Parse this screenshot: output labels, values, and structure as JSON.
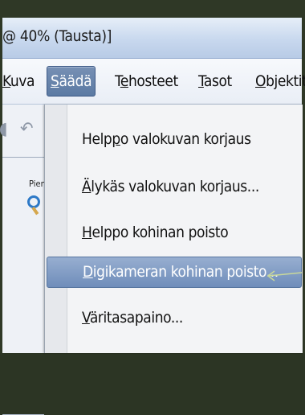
{
  "window": {
    "title": "@ 40% (Tausta)]"
  },
  "menubar": {
    "items": [
      {
        "label": "Kuva",
        "underline_index": 0
      },
      {
        "label": "Säädä",
        "underline_index": 0
      },
      {
        "label": "Tehosteet",
        "underline_index": 1
      },
      {
        "label": "Tasot",
        "underline_index": 0
      },
      {
        "label": "Objektit",
        "underline_index": 0
      }
    ],
    "active": "Säädä"
  },
  "toolbar": {
    "partial_label": "Pien"
  },
  "dropdown": {
    "items": [
      {
        "pre": "Help",
        "u": "p",
        "post": "o valokuvan korjaus"
      },
      {
        "pre": "",
        "u": "Ä",
        "post": "lykäs valokuvan korjaus..."
      },
      {
        "pre": "",
        "u": "H",
        "post": "elppo kohinan poisto"
      },
      {
        "pre": "",
        "u": "D",
        "post": "igikameran kohinan poisto..."
      },
      {
        "pre": "",
        "u": "V",
        "post": "äritasapaino..."
      }
    ],
    "highlighted_index": 3
  },
  "colors": {
    "frame": "#2f3826",
    "menu_active": "#5b7aa3",
    "item_highlight": "#7f9bc4",
    "arrow": "#c9d89a"
  }
}
